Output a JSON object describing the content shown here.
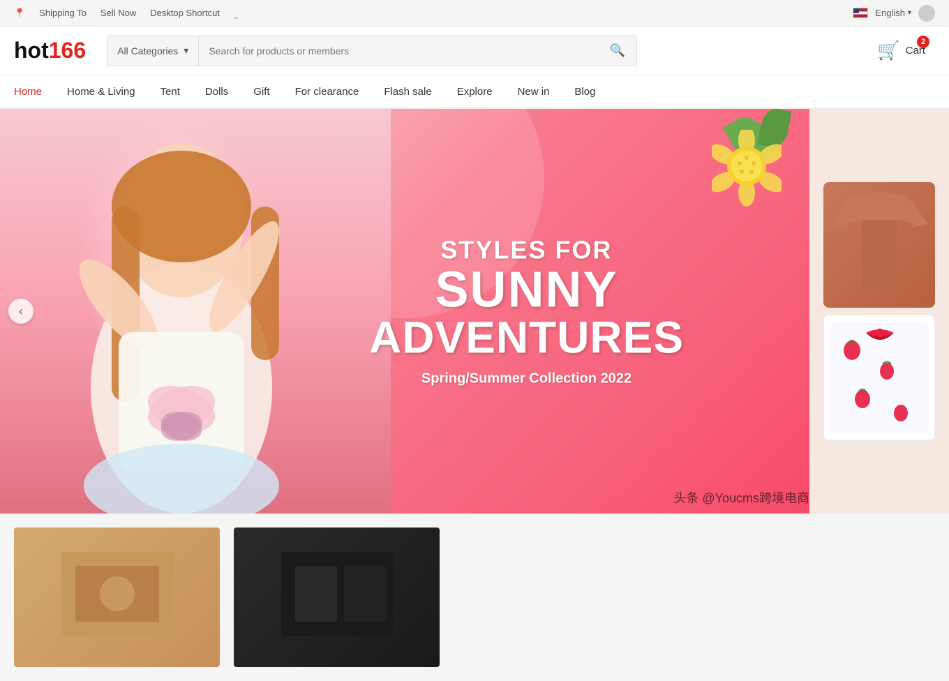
{
  "topBar": {
    "shippingTo": "Shipping To",
    "sellNow": "Sell Now",
    "desktopShortcut": "Desktop Shortcut",
    "language": "English",
    "cartCount": "2",
    "cartLabel": "Cart"
  },
  "header": {
    "logoHot": "hot",
    "logoNum": "166",
    "categoryPlaceholder": "All Categories",
    "searchPlaceholder": "Search for products or members"
  },
  "nav": {
    "items": [
      {
        "id": "home",
        "label": "Home",
        "active": true
      },
      {
        "id": "home-living",
        "label": "Home & Living",
        "active": false
      },
      {
        "id": "tent",
        "label": "Tent",
        "active": false
      },
      {
        "id": "dolls",
        "label": "Dolls",
        "active": false
      },
      {
        "id": "gift",
        "label": "Gift",
        "active": false
      },
      {
        "id": "clearance",
        "label": "For clearance",
        "active": false
      },
      {
        "id": "flash-sale",
        "label": "Flash sale",
        "active": false
      },
      {
        "id": "explore",
        "label": "Explore",
        "active": false
      },
      {
        "id": "new-in",
        "label": "New in",
        "active": false
      },
      {
        "id": "blog",
        "label": "Blog",
        "active": false
      }
    ]
  },
  "banner": {
    "stylesFor": "STYLES FOR",
    "sunny": "SUNNY",
    "adventures": "ADVENTURES",
    "collection": "Spring/Summer Collection 2022"
  },
  "watermark": "头条 @Youcms跨境电商"
}
